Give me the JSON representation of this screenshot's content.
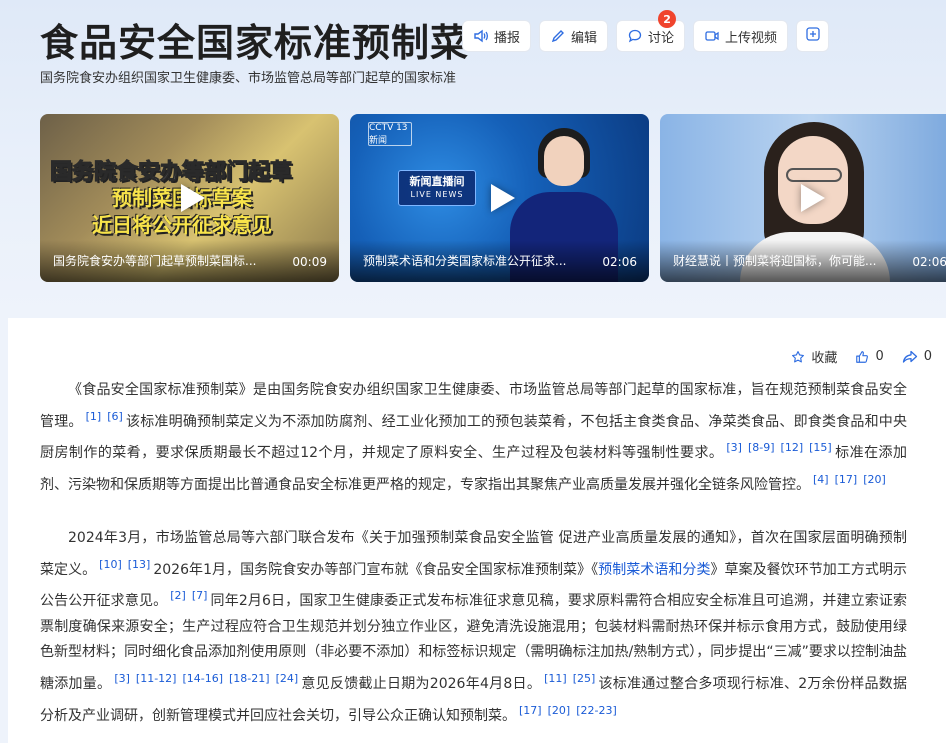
{
  "header": {
    "title": "食品安全国家标准预制菜",
    "subtitle": "国务院食安办组织国家卫生健康委、市场监管总局等部门起草的国家标准",
    "actions": {
      "play": "播报",
      "edit": "编辑",
      "discuss": "讨论",
      "discuss_badge": "2",
      "upload": "上传视频"
    }
  },
  "videos": [
    {
      "title": "国务院食安办等部门起草预制菜国标...",
      "duration": "00:09",
      "overlay_lines": [
        "国务院食安办等部门起草",
        "预制菜国标草案",
        "近日将公开征求意见"
      ]
    },
    {
      "title": "预制菜术语和分类国家标准公开征求...",
      "duration": "02:06",
      "channel_logo": "CCTV 13 新闻",
      "program_logo": "新闻直播间",
      "program_logo_en": "LIVE NEWS"
    },
    {
      "title": "财经慧说丨预制菜将迎国标，你可能...",
      "duration": "02:06"
    }
  ],
  "meta": {
    "collect": "收藏",
    "like_count": "0",
    "share_count": "0"
  },
  "paragraphs": {
    "p1": {
      "s1": "《食品安全国家标准预制菜》是由国务院食安办组织国家卫生健康委、市场监管总局等部门起草的国家标准，旨在规范预制菜食品安全管理。",
      "r1": [
        "[1]",
        "[6]"
      ],
      "s2": "该标准明确预制菜定义为不添加防腐剂、经工业化预加工的预包装菜肴，不包括主食类食品、净菜类食品、即食类食品和中央厨房制作的菜肴，要求保质期最长不超过12个月，并规定了原料安全、生产过程及包装材料等强制性要求。",
      "r2": [
        "[3]",
        "[8-9]",
        "[12]",
        "[15]"
      ],
      "s3": "标准在添加剂、污染物和保质期等方面提出比普通食品安全标准更严格的规定，专家指出其聚焦产业高质量发展并强化全链条风险管控。",
      "r3": [
        "[4]",
        "[17]",
        "[20]"
      ]
    },
    "p2": {
      "s1": "2024年3月，市场监管总局等六部门联合发布《关于加强预制菜食品安全监管 促进产业高质量发展的通知》，首次在国家层面明确预制菜定义。",
      "r1": [
        "[10]",
        "[13]"
      ],
      "s2a": "2026年1月，国务院食安办等部门宣布就《食品安全国家标准预制菜》《",
      "s2link": "预制菜术语和分类",
      "s2b": "》草案及餐饮环节加工方式明示公告公开征求意见。",
      "r2": [
        "[2]",
        "[7]"
      ],
      "s3": "同年2月6日，国家卫生健康委正式发布标准征求意见稿，要求原料需符合相应安全标准且可追溯，并建立索证索票制度确保来源安全；生产过程应符合卫生规范并划分独立作业区，避免清洗设施混用；包装材料需耐热环保并标示食用方式，鼓励使用绿色新型材料；同时细化食品添加剂使用原则（非必要不添加）和标签标识规定（需明确标注加热/熟制方式），同步提出“三减”要求以控制油盐糖添加量。",
      "r3": [
        "[3]",
        "[11-12]",
        "[14-16]",
        "[18-21]",
        "[24]"
      ],
      "s4": "意见反馈截止日期为2026年4月8日。",
      "r4": [
        "[11]",
        "[25]"
      ],
      "s5": "该标准通过整合多项现行标准、2万余份样品数据分析及产业调研，创新管理模式并回应社会关切，引导公众正确认知预制菜。",
      "r5": [
        "[17]",
        "[20]",
        "[22-23]"
      ]
    }
  },
  "colors": {
    "link": "#1a5bd6",
    "badge": "#f0442d",
    "header_bg": "#dfe9f8"
  }
}
